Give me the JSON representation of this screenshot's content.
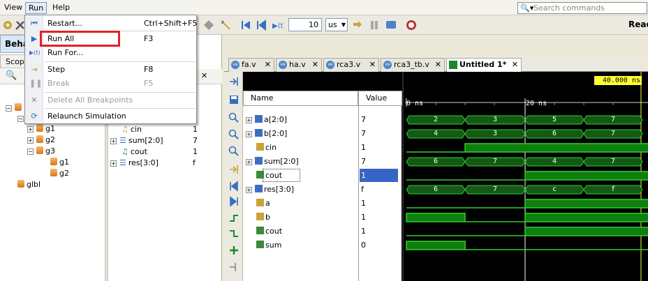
{
  "menubar": {
    "view": "View",
    "run": "Run",
    "help": "Help",
    "search_placeholder": "Search commands"
  },
  "toolbar": {
    "time_value": "10",
    "time_unit": "us",
    "ready": "Read"
  },
  "left_panel": {
    "title": "Beha",
    "scope_tab": "Scope",
    "tree": [
      "g1",
      "g2",
      "g3",
      "g1",
      "g2",
      "glbl"
    ],
    "objects": [
      {
        "name": "cin",
        "value": "1"
      },
      {
        "name": "sum[2:0]",
        "value": "7"
      },
      {
        "name": "cout",
        "value": "1"
      },
      {
        "name": "res[3:0]",
        "value": "f"
      }
    ]
  },
  "run_menu": {
    "items": [
      {
        "label": "Restart...",
        "shortcut": "Ctrl+Shift+F5",
        "disabled": false
      },
      {
        "label": "Run All",
        "shortcut": "F3",
        "disabled": false
      },
      {
        "label": "Run For...",
        "shortcut": "",
        "disabled": false
      },
      {
        "label": "Step",
        "shortcut": "F8",
        "disabled": false
      },
      {
        "label": "Break",
        "shortcut": "F5",
        "disabled": true
      },
      {
        "label": "Delete All Breakpoints",
        "shortcut": "",
        "disabled": true
      },
      {
        "label": "Relaunch Simulation",
        "shortcut": "",
        "disabled": false
      }
    ]
  },
  "doc_tabs": [
    {
      "label": "fa.v"
    },
    {
      "label": "ha.v"
    },
    {
      "label": "rca3.v"
    },
    {
      "label": "rca3_tb.v"
    },
    {
      "label": "Untitled 1*"
    }
  ],
  "wave": {
    "name_header": "Name",
    "value_header": "Value",
    "timestamp": "40.000 ns",
    "ticks": [
      "0 ns",
      "20 ns"
    ],
    "signals": [
      {
        "name": "a[2:0]",
        "value": "7",
        "bus": [
          "2",
          "3",
          "5",
          "7"
        ]
      },
      {
        "name": "b[2:0]",
        "value": "7",
        "bus": [
          "4",
          "3",
          "6",
          "7"
        ]
      },
      {
        "name": "cin",
        "value": "1"
      },
      {
        "name": "sum[2:0]",
        "value": "7",
        "bus": [
          "6",
          "7",
          "4",
          "7"
        ]
      },
      {
        "name": "cout",
        "value": "1"
      },
      {
        "name": "res[3:0]",
        "value": "f",
        "bus": [
          "6",
          "7",
          "c",
          "f"
        ]
      },
      {
        "name": "a",
        "value": "1"
      },
      {
        "name": "b",
        "value": "1"
      },
      {
        "name": "cout",
        "value": "1"
      },
      {
        "name": "sum",
        "value": "0"
      }
    ]
  },
  "colors": {
    "wave_green": "#1f9f1f",
    "wave_high": "#0e7e0e",
    "highlight_red": "#e3202a",
    "timestamp_bg": "#ffff33"
  }
}
